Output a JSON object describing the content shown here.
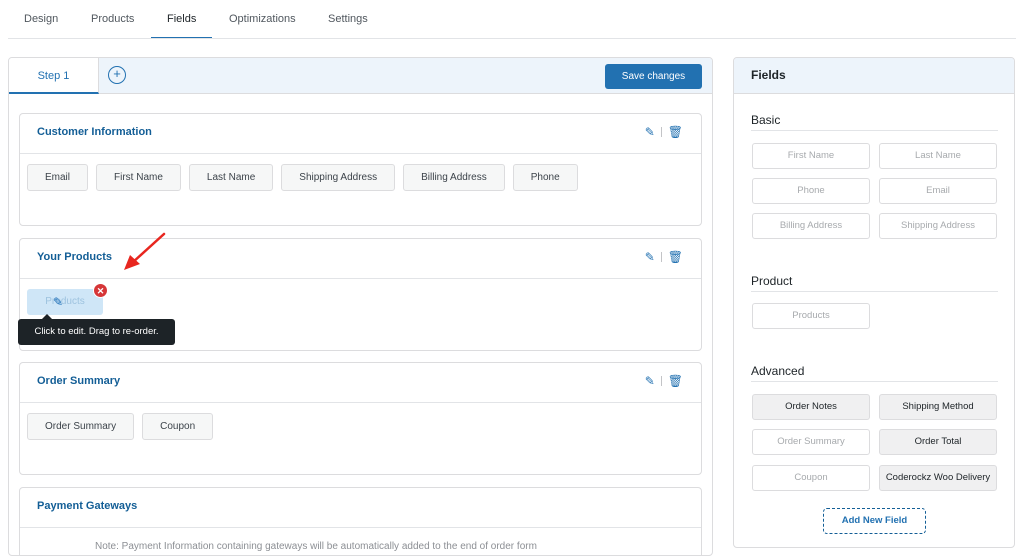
{
  "top_tabs": [
    "Design",
    "Products",
    "Fields",
    "Optimizations",
    "Settings"
  ],
  "active_tab": "Fields",
  "step_tab": "Step 1",
  "add_step_icon": "+",
  "save_label": "Save changes",
  "sections": [
    {
      "title": "Customer Information",
      "fields": [
        "Email",
        "First Name",
        "Last Name",
        "Shipping Address",
        "Billing Address",
        "Phone"
      ]
    },
    {
      "title": "Your Products",
      "fields": [
        "Products"
      ]
    },
    {
      "title": "Order Summary",
      "fields": [
        "Order Summary",
        "Coupon"
      ]
    },
    {
      "title": "Payment Gateways",
      "note": "Note: Payment Information containing gateways will be automatically added to the end of order form"
    }
  ],
  "tooltip": "Click to edit. Drag to re-order.",
  "panel": {
    "title": "Fields",
    "groups": [
      {
        "title": "Basic",
        "items": [
          "First Name",
          "Last Name",
          "Phone",
          "Email",
          "Billing Address",
          "Shipping Address"
        ]
      },
      {
        "title": "Product",
        "items": [
          "Products"
        ]
      },
      {
        "title": "Advanced",
        "items": [
          "Order Notes",
          "Shipping Method",
          "Order Summary",
          "Order Total",
          "Coupon",
          "Coderockz Woo Delivery"
        ]
      }
    ],
    "add_label": "Add New Field"
  },
  "colors": {
    "accent": "#2271b1",
    "remove": "#d63638",
    "arrow": "#e8261f"
  }
}
